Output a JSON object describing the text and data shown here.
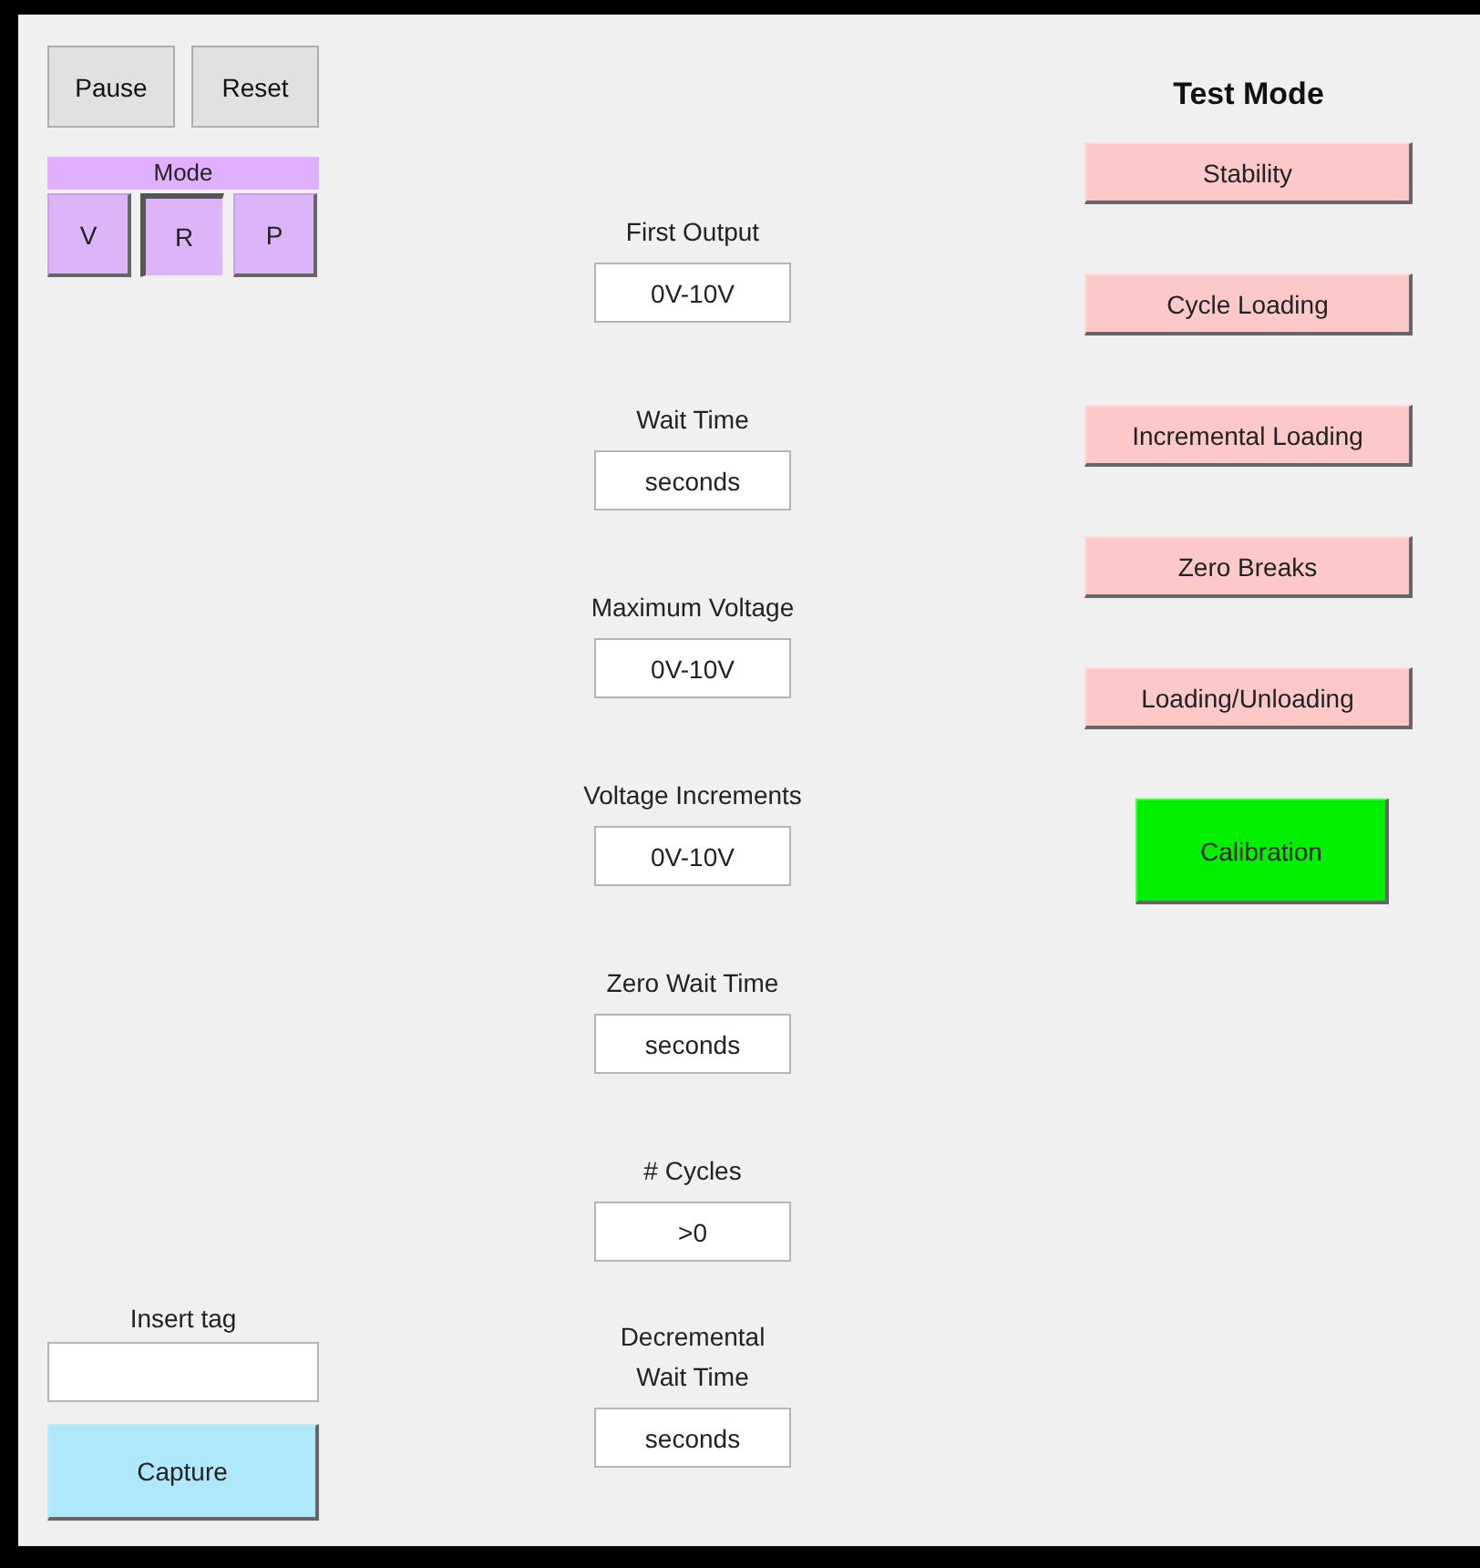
{
  "controls": [
    {
      "label": "Pause"
    },
    {
      "label": "Reset"
    }
  ],
  "mode": {
    "title": "Mode",
    "options": [
      {
        "label": "V",
        "selected": false
      },
      {
        "label": "R",
        "selected": true
      },
      {
        "label": "P",
        "selected": false
      }
    ]
  },
  "tag": {
    "label": "Insert tag",
    "button": "Capture"
  },
  "parameters": [
    {
      "label": "First Output",
      "value": "0V-10V"
    },
    {
      "label": "Wait Time",
      "value": "seconds"
    },
    {
      "label": "Maximum Voltage",
      "value": "0V-10V"
    },
    {
      "label": "Voltage Increments",
      "value": "0V-10V"
    },
    {
      "label": "Zero Wait Time",
      "value": "seconds"
    },
    {
      "label": "# Cycles",
      "value": ">0"
    },
    {
      "label": "Decremental\nWait Time",
      "value": "seconds"
    }
  ],
  "test_mode": {
    "title": "Test Mode",
    "buttons": [
      {
        "label": "Stability",
        "kind": "test"
      },
      {
        "label": "Cycle Loading",
        "kind": "test"
      },
      {
        "label": "Incremental Loading",
        "kind": "test"
      },
      {
        "label": "Zero Breaks",
        "kind": "test"
      },
      {
        "label": "Loading/Unloading",
        "kind": "test"
      },
      {
        "label": "Calibration",
        "kind": "calibration"
      }
    ]
  }
}
